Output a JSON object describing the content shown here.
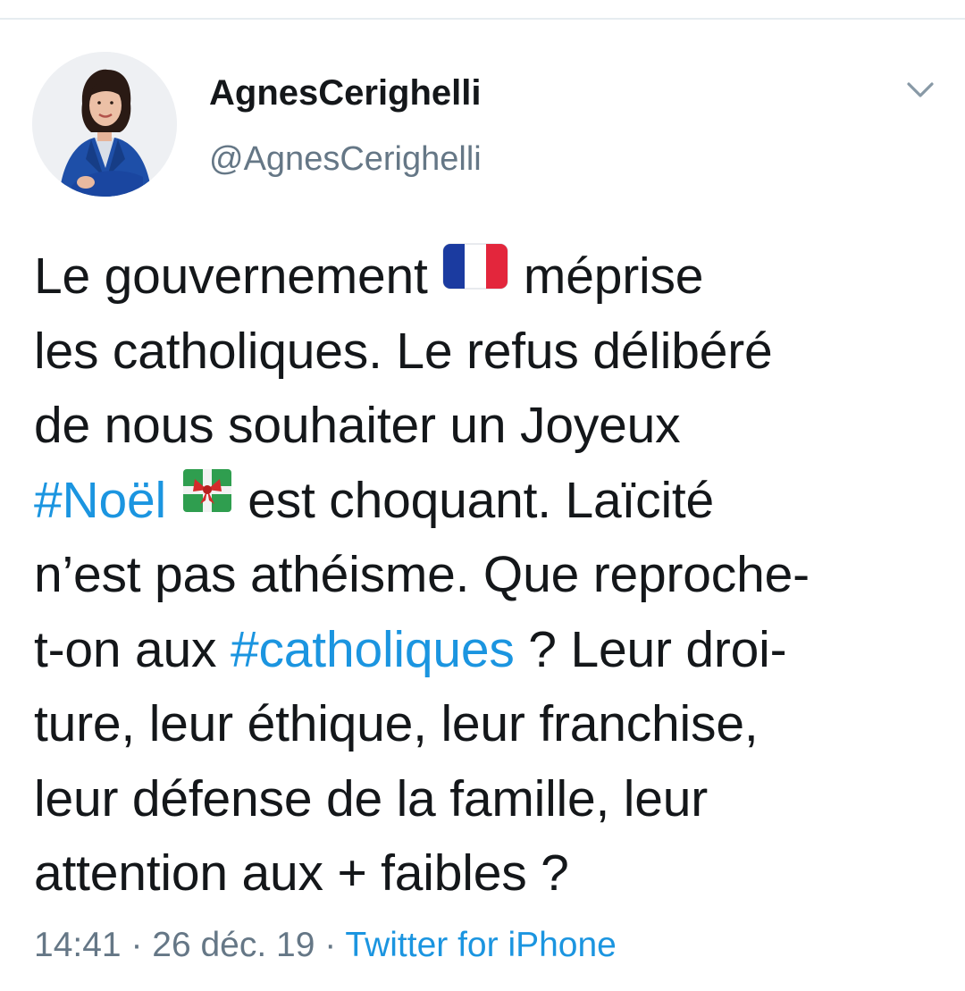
{
  "author": {
    "display_name": "AgnesCerighelli",
    "handle": "@AgnesCerighelli"
  },
  "tweet": {
    "line1_a": "Le gouvernement ",
    "line1_emoji": "france-flag",
    "line1_b": " méprise",
    "line2": "les catholiques. Le refus délibéré",
    "line3": "de nous souhaiter un Joyeux",
    "line4_hashtag": "#Noël",
    "line4_emoji": "wrapped-gift",
    "line4_b": "  est choquant. Laïcité",
    "line5": "n’est pas athéisme. Que reproche-",
    "line6_a": "t-on aux ",
    "line6_hashtag": "#catholiques",
    "line6_b": " ? Leur droi-",
    "line7": "ture, leur éthique, leur franchise,",
    "line8": "leur défense de la famille, leur",
    "line9": "attention aux + faibles ?"
  },
  "meta": {
    "time": "14:41",
    "sep1": " · ",
    "date": "26 déc. 19",
    "sep2": " · ",
    "source": "Twitter for iPhone"
  },
  "colors": {
    "text": "#14171a",
    "secondary": "#657786",
    "link": "#1b95e0",
    "divider": "#e6ecf0"
  }
}
